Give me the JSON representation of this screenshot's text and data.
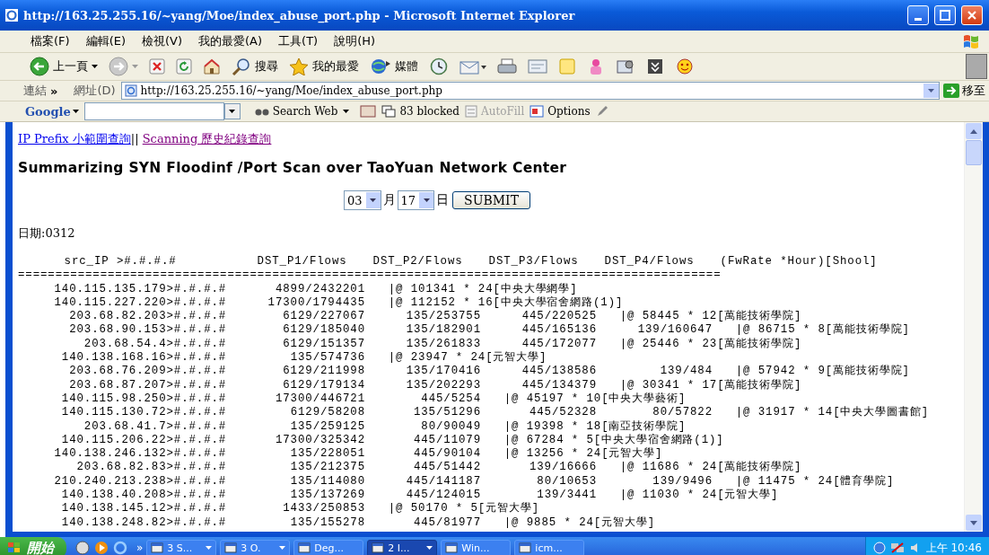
{
  "window": {
    "title": "http://163.25.255.16/~yang/Moe/index_abuse_port.php - Microsoft Internet Explorer"
  },
  "menu": [
    "檔案(F)",
    "編輯(E)",
    "檢視(V)",
    "我的最愛(A)",
    "工具(T)",
    "說明(H)"
  ],
  "toolbar": [
    {
      "kind": "back",
      "label": "上一頁"
    },
    {
      "kind": "forward"
    },
    {
      "kind": "stop"
    },
    {
      "kind": "refresh"
    },
    {
      "kind": "home"
    },
    {
      "kind": "search",
      "label": "搜尋"
    },
    {
      "kind": "favorites",
      "label": "我的最愛"
    },
    {
      "kind": "media",
      "label": "媒體"
    },
    {
      "kind": "history"
    },
    {
      "kind": "mail"
    },
    {
      "kind": "print"
    },
    {
      "kind": "edit"
    },
    {
      "kind": "note"
    },
    {
      "kind": "messenger"
    },
    {
      "kind": "tool"
    },
    {
      "kind": "save"
    },
    {
      "kind": "smiley"
    }
  ],
  "address": {
    "links_label": "連結",
    "chevron": "»",
    "label": "網址(D)",
    "url": "http://163.25.255.16/~yang/Moe/index_abuse_port.php",
    "go": "移至"
  },
  "google": {
    "logo": "Google",
    "search_label": "Search Web",
    "blocked": "83 blocked",
    "autofill": "AutoFill",
    "autofill_disabled": true,
    "options": "Options"
  },
  "content": {
    "links": [
      {
        "text": "IP Prefix 小範圍查詢",
        "visited": false
      },
      {
        "text": "Scanning 歷史紀錄查詢",
        "visited": true
      }
    ],
    "separator": "||",
    "heading": "Summarizing SYN Floodinf /Port Scan over TaoYuan Network Center",
    "form": {
      "month": "03",
      "month_label": "月",
      "day": "17",
      "day_label": "日",
      "submit": "SUBMIT"
    },
    "date_line": "日期:0312",
    "report": {
      "columns": [
        "src_IP >#.#.#.#",
        "DST_P1/Flows",
        "DST_P2/Flows",
        "DST_P3/Flows",
        "DST_P4/Flows",
        "(FwRate *Hour)[Shool]"
      ],
      "rule": "==============================================================================================",
      "rows": [
        {
          "src": "140.115.135.179>#.#.#.#",
          "ports": [
            "4899/2432201"
          ],
          "tail": "|@ 101341 * 24[中央大學網學]"
        },
        {
          "src": "140.115.227.220>#.#.#.#",
          "ports": [
            "17300/1794435"
          ],
          "tail": "|@ 112152 * 16[中央大學宿舍網路(1)]"
        },
        {
          "src": "203.68.82.203>#.#.#.#",
          "ports": [
            "6129/227067",
            "135/253755",
            "445/220525"
          ],
          "tail": "|@ 58445 * 12[萬能技術學院]"
        },
        {
          "src": "203.68.90.153>#.#.#.#",
          "ports": [
            "6129/185040",
            "135/182901",
            "445/165136",
            "139/160647"
          ],
          "tail": "|@ 86715 * 8[萬能技術學院]"
        },
        {
          "src": "203.68.54.4>#.#.#.#",
          "ports": [
            "6129/151357",
            "135/261833",
            "445/172077"
          ],
          "tail": "|@ 25446 * 23[萬能技術學院]"
        },
        {
          "src": "140.138.168.16>#.#.#.#",
          "ports": [
            "135/574736"
          ],
          "tail": "|@ 23947 * 24[元智大學]"
        },
        {
          "src": "203.68.76.209>#.#.#.#",
          "ports": [
            "6129/211998",
            "135/170416",
            "445/138586",
            "139/484"
          ],
          "tail": "|@ 57942 * 9[萬能技術學院]"
        },
        {
          "src": "203.68.87.207>#.#.#.#",
          "ports": [
            "6129/179134",
            "135/202293",
            "445/134379"
          ],
          "tail": "|@ 30341 * 17[萬能技術學院]"
        },
        {
          "src": "140.115.98.250>#.#.#.#",
          "ports": [
            "17300/446721",
            "445/5254"
          ],
          "tail": "|@ 45197 * 10[中央大學藝術]"
        },
        {
          "src": "140.115.130.72>#.#.#.#",
          "ports": [
            "6129/58208",
            "135/51296",
            "445/52328",
            "80/57822"
          ],
          "tail": "|@ 31917 * 14[中央大學圖書館]"
        },
        {
          "src": "203.68.41.7>#.#.#.#",
          "ports": [
            "135/259125",
            "80/90049"
          ],
          "tail": "|@ 19398 * 18[南亞技術學院]"
        },
        {
          "src": "140.115.206.22>#.#.#.#",
          "ports": [
            "17300/325342",
            "445/11079"
          ],
          "tail": "|@ 67284 * 5[中央大學宿舍網路(1)]"
        },
        {
          "src": "140.138.246.132>#.#.#.#",
          "ports": [
            "135/228051",
            "445/90104"
          ],
          "tail": "|@ 13256 * 24[元智大學]"
        },
        {
          "src": "203.68.82.83>#.#.#.#",
          "ports": [
            "135/212375",
            "445/51442",
            "139/16666"
          ],
          "tail": "|@ 11686 * 24[萬能技術學院]"
        },
        {
          "src": "210.240.213.238>#.#.#.#",
          "ports": [
            "135/114080",
            "445/141187",
            "80/10653",
            "139/9496"
          ],
          "tail": "|@ 11475 * 24[體育學院]"
        },
        {
          "src": "140.138.40.208>#.#.#.#",
          "ports": [
            "135/137269",
            "445/124015",
            "139/3441"
          ],
          "tail": "|@ 11030 * 24[元智大學]"
        },
        {
          "src": "140.138.145.12>#.#.#.#",
          "ports": [
            "1433/250853"
          ],
          "tail": "|@ 50170 * 5[元智大學]"
        },
        {
          "src": "140.138.248.82>#.#.#.#",
          "ports": [
            "135/155278",
            "445/81977"
          ],
          "tail": "|@ 9885 * 24[元智大學]"
        }
      ]
    }
  },
  "taskbar": {
    "start": "開始",
    "overflow": "»",
    "tasks": [
      {
        "label": "3 S...",
        "grouped": true,
        "selected": false
      },
      {
        "label": "3 O.",
        "grouped": true,
        "selected": false
      },
      {
        "label": "Deg...",
        "grouped": false,
        "selected": false
      },
      {
        "label": "2 I...",
        "grouped": true,
        "selected": true
      },
      {
        "label": "Win...",
        "grouped": false,
        "selected": false
      },
      {
        "label": "icm...",
        "grouped": false,
        "selected": false
      }
    ],
    "clock": "上午 10:46"
  }
}
